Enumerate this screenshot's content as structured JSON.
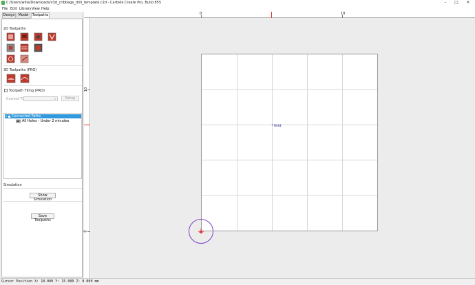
{
  "window": {
    "title": "C:/Users/willa/Downloads/v3d_cribbage_drill_template.c2d - Carbide Create Pro, Build 855",
    "controls": [
      "–",
      "□",
      "✕"
    ]
  },
  "menu": [
    "File",
    "Edit",
    "Library",
    "View",
    "Help"
  ],
  "tabs": [
    "Design",
    "Model",
    "Toolpaths"
  ],
  "active_tab": "Toolpaths",
  "toolpaths_panel": {
    "section_2d": "2D Toolpaths",
    "section_3d": "3D Toolpaths (PRO)",
    "tiling_label": "Toolpath Tiling (PRO)",
    "current_tile_label": "Current Tile",
    "setup_button": "Setup",
    "tree": {
      "group": "Connected Paths",
      "item": "All Holes - Under 2 minutes"
    }
  },
  "simulation": {
    "label": "Simulation",
    "show_button": "Show Simulation",
    "save_button": "Save Toolpaths"
  },
  "canvas": {
    "ruler_top_labels": [
      "0",
      "10"
    ],
    "ruler_left_labels": [
      "10",
      "0"
    ],
    "grid_label": "Grid"
  },
  "status": {
    "cursor_text": "Cursor Position X: 10.000 Y: 15.000 Z: 0.000 mm"
  },
  "colors": {
    "selection": "#3399dd",
    "ruler_marker": "#e03030",
    "origin_circle": "#7b3fc4",
    "grid_label": "#1a237e",
    "tool_icon": "#c0392b"
  }
}
